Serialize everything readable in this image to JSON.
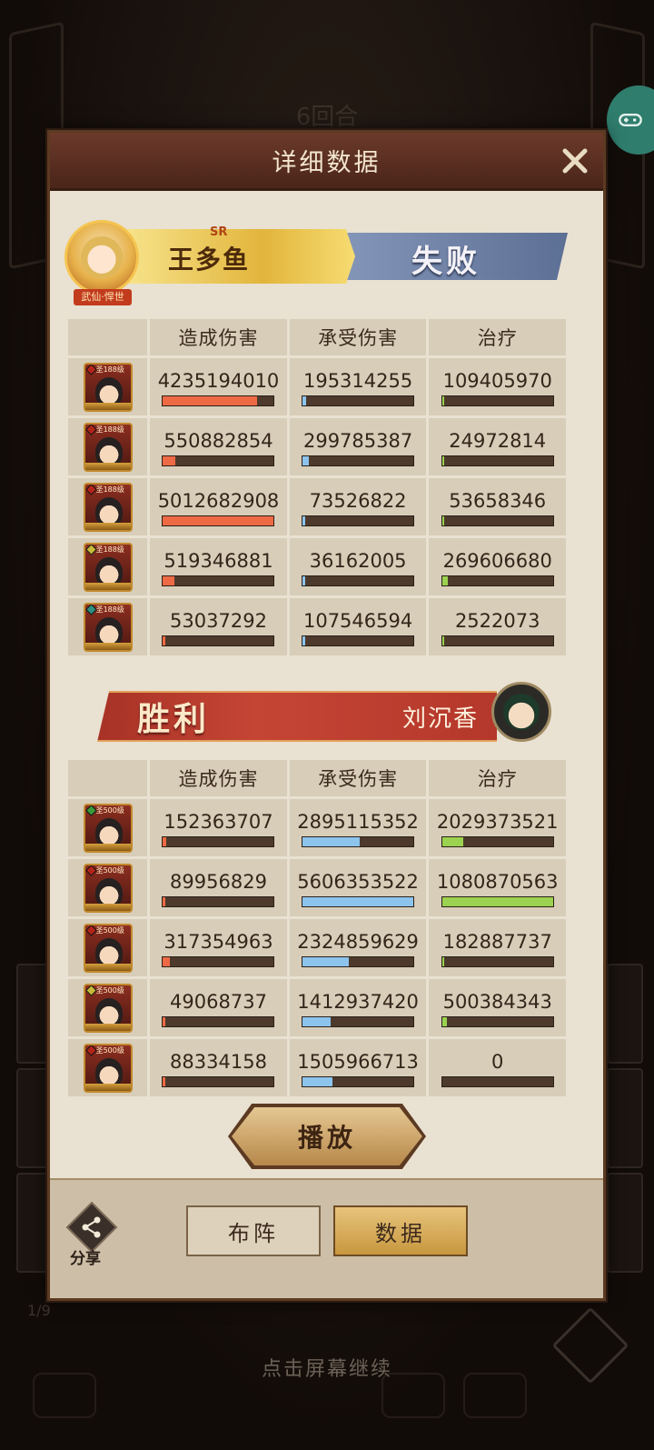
{
  "background": {
    "round_label": "6回合",
    "continue_hint": "点击屏幕继续",
    "page_counter": "1/9"
  },
  "panel": {
    "title": "详细数据",
    "play_label": "播放",
    "footer": {
      "share_label": "分享",
      "lineup_tab": "布阵",
      "data_tab": "数据"
    }
  },
  "headers": {
    "damage_dealt": "造成伤害",
    "damage_taken": "承受伤害",
    "healing": "治疗"
  },
  "colors": {
    "damage_bar": "#ee6a45",
    "taken_bar": "#8cc4ee",
    "heal_bar": "#9bd24f"
  },
  "team_top": {
    "player_name": "王多鱼",
    "rarity": "SR",
    "title_tag": "武仙·悍世",
    "result": "失败",
    "heroes": [
      {
        "level": "圣188级",
        "gem": "#b2241a",
        "dmg": "4235194010",
        "taken": "195314255",
        "heal": "109405970",
        "dmg_pct": 0.845,
        "taken_pct": 0.035,
        "heal_pct": 0.02
      },
      {
        "level": "圣188级",
        "gem": "#b2241a",
        "dmg": "550882854",
        "taken": "299785387",
        "heal": "24972814",
        "dmg_pct": 0.11,
        "taken_pct": 0.053,
        "heal_pct": 0.005
      },
      {
        "level": "圣188级",
        "gem": "#b2241a",
        "dmg": "5012682908",
        "taken": "73526822",
        "heal": "53658346",
        "dmg_pct": 1.0,
        "taken_pct": 0.013,
        "heal_pct": 0.01
      },
      {
        "level": "圣188级",
        "gem": "#c7b93a",
        "dmg": "519346881",
        "taken": "36162005",
        "heal": "269606680",
        "dmg_pct": 0.104,
        "taken_pct": 0.006,
        "heal_pct": 0.05
      },
      {
        "level": "圣188级",
        "gem": "#2f8f80",
        "dmg": "53037292",
        "taken": "107546594",
        "heal": "2522073",
        "dmg_pct": 0.011,
        "taken_pct": 0.019,
        "heal_pct": 0.001
      }
    ]
  },
  "team_bottom": {
    "player_name": "刘沉香",
    "result": "胜利",
    "heroes": [
      {
        "level": "圣500级",
        "gem": "#3a9a3a",
        "dmg": "152363707",
        "taken": "2895115352",
        "heal": "2029373521",
        "dmg_pct": 0.03,
        "taken_pct": 0.516,
        "heal_pct": 0.188
      },
      {
        "level": "圣500级",
        "gem": "#b2241a",
        "dmg": "89956829",
        "taken": "5606353522",
        "heal": "1080870563",
        "dmg_pct": 0.018,
        "taken_pct": 1.0,
        "heal_pct": 1.0
      },
      {
        "level": "圣500级",
        "gem": "#b2241a",
        "dmg": "317354963",
        "taken": "2324859629",
        "heal": "182887737",
        "dmg_pct": 0.063,
        "taken_pct": 0.415,
        "heal_pct": 0.017
      },
      {
        "level": "圣500级",
        "gem": "#c7b93a",
        "dmg": "49068737",
        "taken": "1412937420",
        "heal": "500384343",
        "dmg_pct": 0.01,
        "taken_pct": 0.252,
        "heal_pct": 0.046
      },
      {
        "level": "圣500级",
        "gem": "#b2241a",
        "dmg": "88334158",
        "taken": "1505966713",
        "heal": "0",
        "dmg_pct": 0.018,
        "taken_pct": 0.269,
        "heal_pct": 0.0
      }
    ]
  }
}
